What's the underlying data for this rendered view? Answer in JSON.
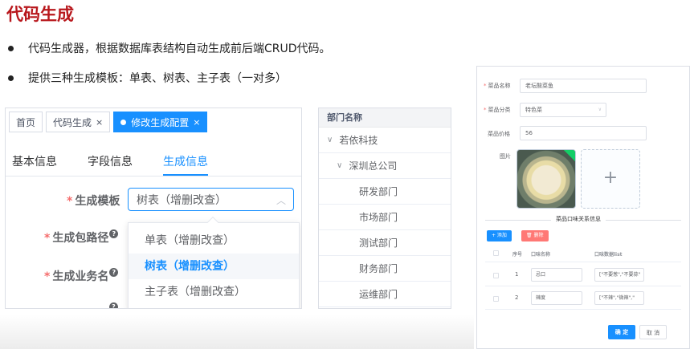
{
  "slide": {
    "title": "代码生成",
    "bullets": [
      "代码生成器，根据数据库表结构自动生成前后端CRUD代码。",
      "提供三种生成模板：单表、树表、主子表（一对多）"
    ]
  },
  "gen_panel": {
    "tags": [
      {
        "label": "首页"
      },
      {
        "label": "代码生成",
        "close": "×"
      },
      {
        "label": "修改生成配置",
        "close": "×"
      }
    ],
    "sub_tabs": [
      "基本信息",
      "字段信息",
      "生成信息"
    ],
    "active_sub_tab": "生成信息",
    "fields": {
      "template_label": "生成模板",
      "package_label": "生成包路径",
      "business_label": "生成业务名",
      "required_mark": "*",
      "help_mark": "?"
    },
    "template_select": {
      "value": "树表（增删改查）",
      "options": [
        "单表（增删改查）",
        "树表（增删改查）",
        "主子表（增删改查）"
      ]
    }
  },
  "dept_tree": {
    "header": "部门名称",
    "rows": [
      {
        "label": "若依科技",
        "level": 0,
        "caret": "∨"
      },
      {
        "label": "深圳总公司",
        "level": 1,
        "caret": "∨"
      },
      {
        "label": "研发部门",
        "level": 2
      },
      {
        "label": "市场部门",
        "level": 2
      },
      {
        "label": "测试部门",
        "level": 2
      },
      {
        "label": "财务部门",
        "level": 2
      },
      {
        "label": "运维部门",
        "level": 2
      }
    ]
  },
  "dish_form": {
    "name_label": "菜品名称",
    "name_value": "老坛酸菜鱼",
    "category_label": "菜品分类",
    "category_value": "特色菜",
    "price_label": "菜品价格",
    "price_value": "56",
    "image_label": "图片",
    "upload_plus": "+",
    "section_title": "菜品口味关系信息",
    "add_button": "+ 添加",
    "delete_button": "🗑 删除",
    "table_headers": [
      "序号",
      "口味名称",
      "口味数据list"
    ],
    "rows": [
      {
        "index": "1",
        "name": "忌口",
        "list": "[\"不要葱\",\"不要蒜\""
      },
      {
        "index": "2",
        "name": "辣度",
        "list": "[\"不辣\",\"微辣\",\""
      }
    ],
    "confirm_button": "确 定",
    "cancel_button": "取 消"
  },
  "colors": {
    "title_red": "#b8171c",
    "primary_blue": "#1890ff",
    "danger_red": "#f56c6c"
  }
}
